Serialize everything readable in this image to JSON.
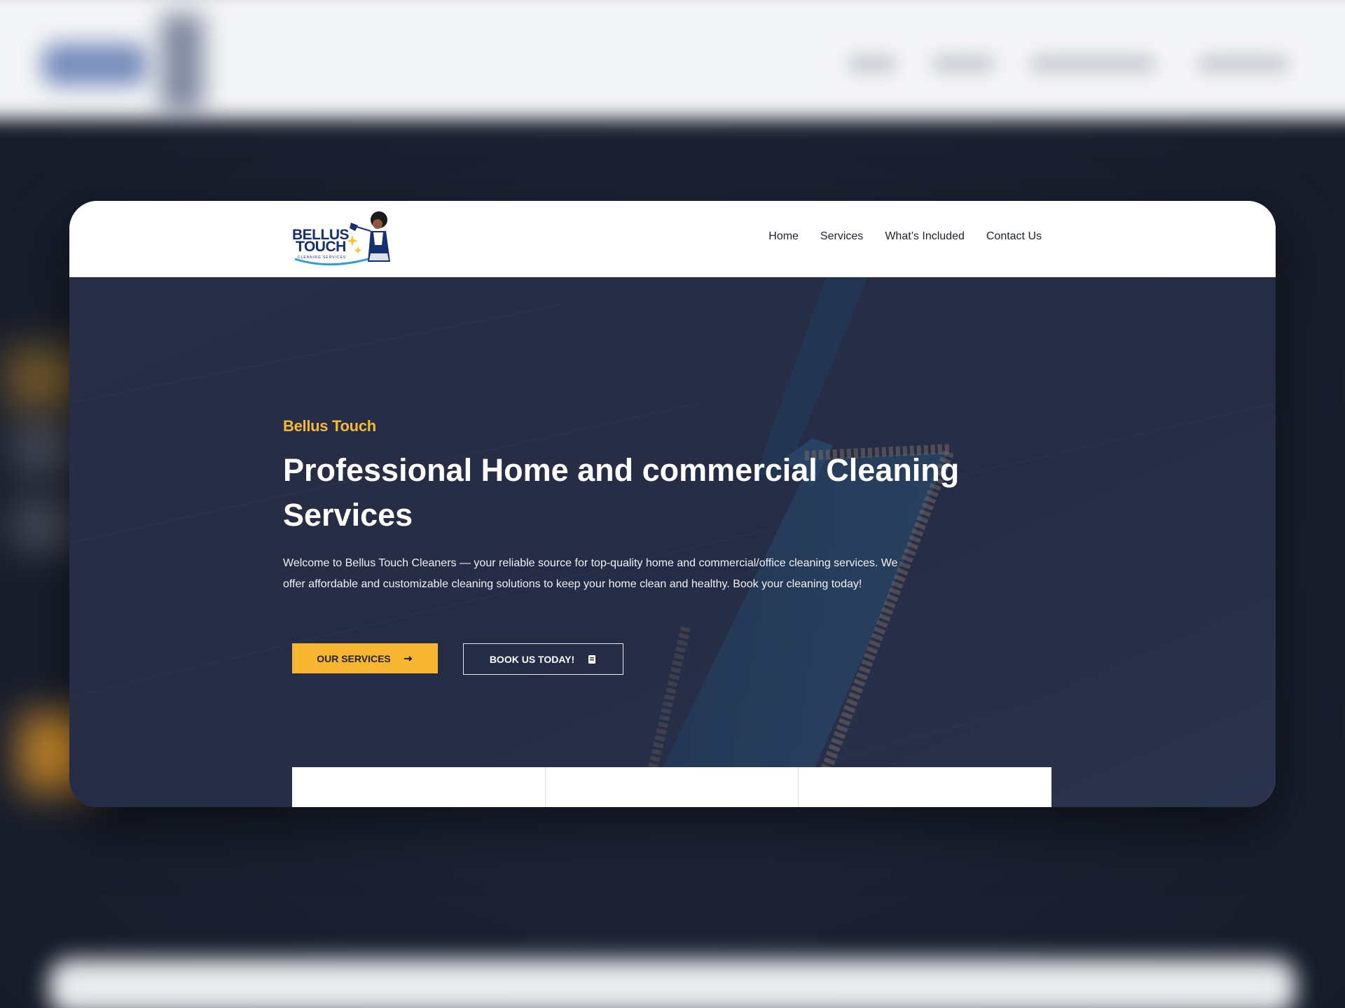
{
  "brand": {
    "name_line1": "BELLUS",
    "name_line2": "TOUCH",
    "tagline": "CLEANING SERVICES"
  },
  "nav": {
    "items": [
      {
        "label": "Home"
      },
      {
        "label": "Services"
      },
      {
        "label": "What’s Included"
      },
      {
        "label": "Contact Us"
      }
    ]
  },
  "hero": {
    "eyebrow": "Bellus Touch",
    "title": "Professional Home and commercial Cleaning Services",
    "description": "Welcome to Bellus Touch Cleaners — your reliable source for top-quality home and commercial/office cleaning services. We offer affordable and customizable cleaning solutions to keep your home clean and healthy. Book your cleaning today!",
    "buttons": {
      "services": {
        "label": "OUR SERVICES",
        "icon": "arrow-right-icon"
      },
      "book": {
        "label": "BOOK US TODAY!",
        "icon": "book-icon"
      }
    }
  },
  "colors": {
    "accent": "#f8b531",
    "hero_bg": "#262d45",
    "brand_navy": "#15306e",
    "header_bg": "#ffffff"
  }
}
